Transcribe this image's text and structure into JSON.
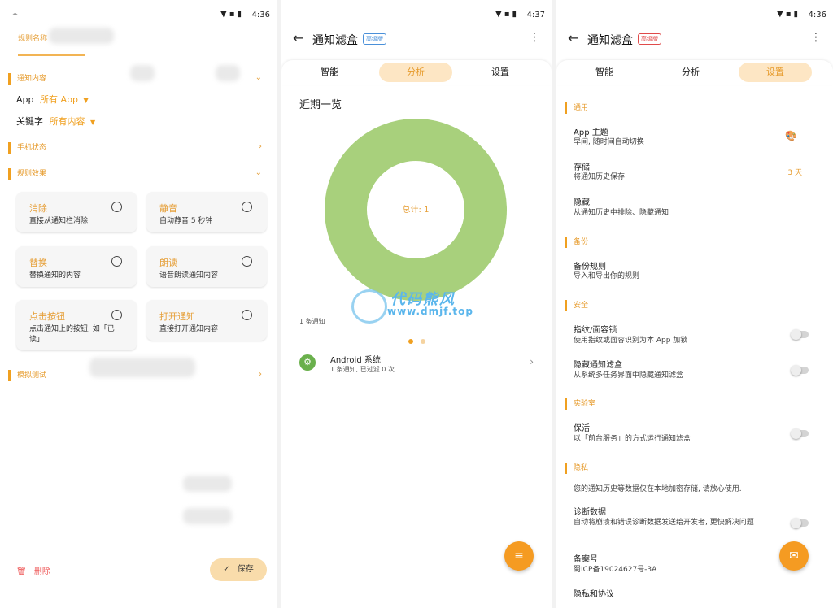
{
  "panel1": {
    "tab_title": "规则名称",
    "sections": {
      "notify_content": "通知内容",
      "phone_state": "手机状态",
      "rule_effect": "规则效果",
      "simulate": "模拟测试"
    },
    "app_label": "App",
    "app_value": "所有 App",
    "keyword_label": "关键字",
    "keyword_value": "所有内容",
    "cards": [
      {
        "title": "消除",
        "sub": "直接从通知栏消除"
      },
      {
        "title": "静音",
        "sub": "自动静音 5 秒钟"
      },
      {
        "title": "替换",
        "sub": "替换通知的内容"
      },
      {
        "title": "朗读",
        "sub": "语音朗读通知内容"
      },
      {
        "title": "点击按钮",
        "sub": "点击通知上的按钮, 如「已读」"
      },
      {
        "title": "打开通知",
        "sub": "直接打开通知内容"
      }
    ],
    "delete_label": "删除",
    "save_label": "保存"
  },
  "panel2": {
    "time": "4:37",
    "title": "通知滤盒",
    "badge": "高级版",
    "tabs": [
      "智能",
      "分析",
      "设置"
    ],
    "recent": "近期一览",
    "total": "总计: 1",
    "note_count": "1 条通知",
    "item_title": "Android 系统",
    "item_sub": "1 条通知, 已过滤 0 次"
  },
  "panel3": {
    "time": "4:36",
    "title": "通知滤盒",
    "badge": "高级版",
    "tabs": [
      "智能",
      "分析",
      "设置"
    ],
    "sections": {
      "general": "通用",
      "backup": "备份",
      "security": "安全",
      "lab": "实验室",
      "privacy": "隐私"
    },
    "items": {
      "theme_t": "App 主题",
      "theme_s": "早间, 随时间自动切换",
      "storage_t": "存储",
      "storage_s": "将通知历史保存",
      "storage_v": "3 天",
      "hide_t": "隐藏",
      "hide_s": "从通知历史中排除、隐藏通知",
      "backup_t": "备份规则",
      "backup_s": "导入和导出你的规则",
      "lock_t": "指纹/面容锁",
      "lock_s": "使用指纹或面容识别为本 App 加锁",
      "hideapp_t": "隐藏通知滤盒",
      "hideapp_s": "从系统多任务界面中隐藏通知滤盒",
      "keep_t": "保活",
      "keep_s": "以「前台服务」的方式运行通知滤盒",
      "privacy_note": "您的通知历史等数据仅在本地加密存储, 请放心使用.",
      "diag_t": "诊断数据",
      "diag_s": "自动将崩溃和错误诊断数据发送给开发者, 更快解决问题",
      "icp_t": "备案号",
      "icp_s": "蜀ICP备19024627号-3A",
      "policy_t": "隐私和协议"
    }
  },
  "panel1_time": "4:36",
  "watermark": {
    "title": "代码熊风",
    "sub": "www.dmjf.top"
  },
  "chart_data": {
    "type": "pie",
    "title": "近期一览",
    "center_label": "总计: 1",
    "values": [
      1
    ],
    "colors": [
      "#a8d07c"
    ]
  }
}
